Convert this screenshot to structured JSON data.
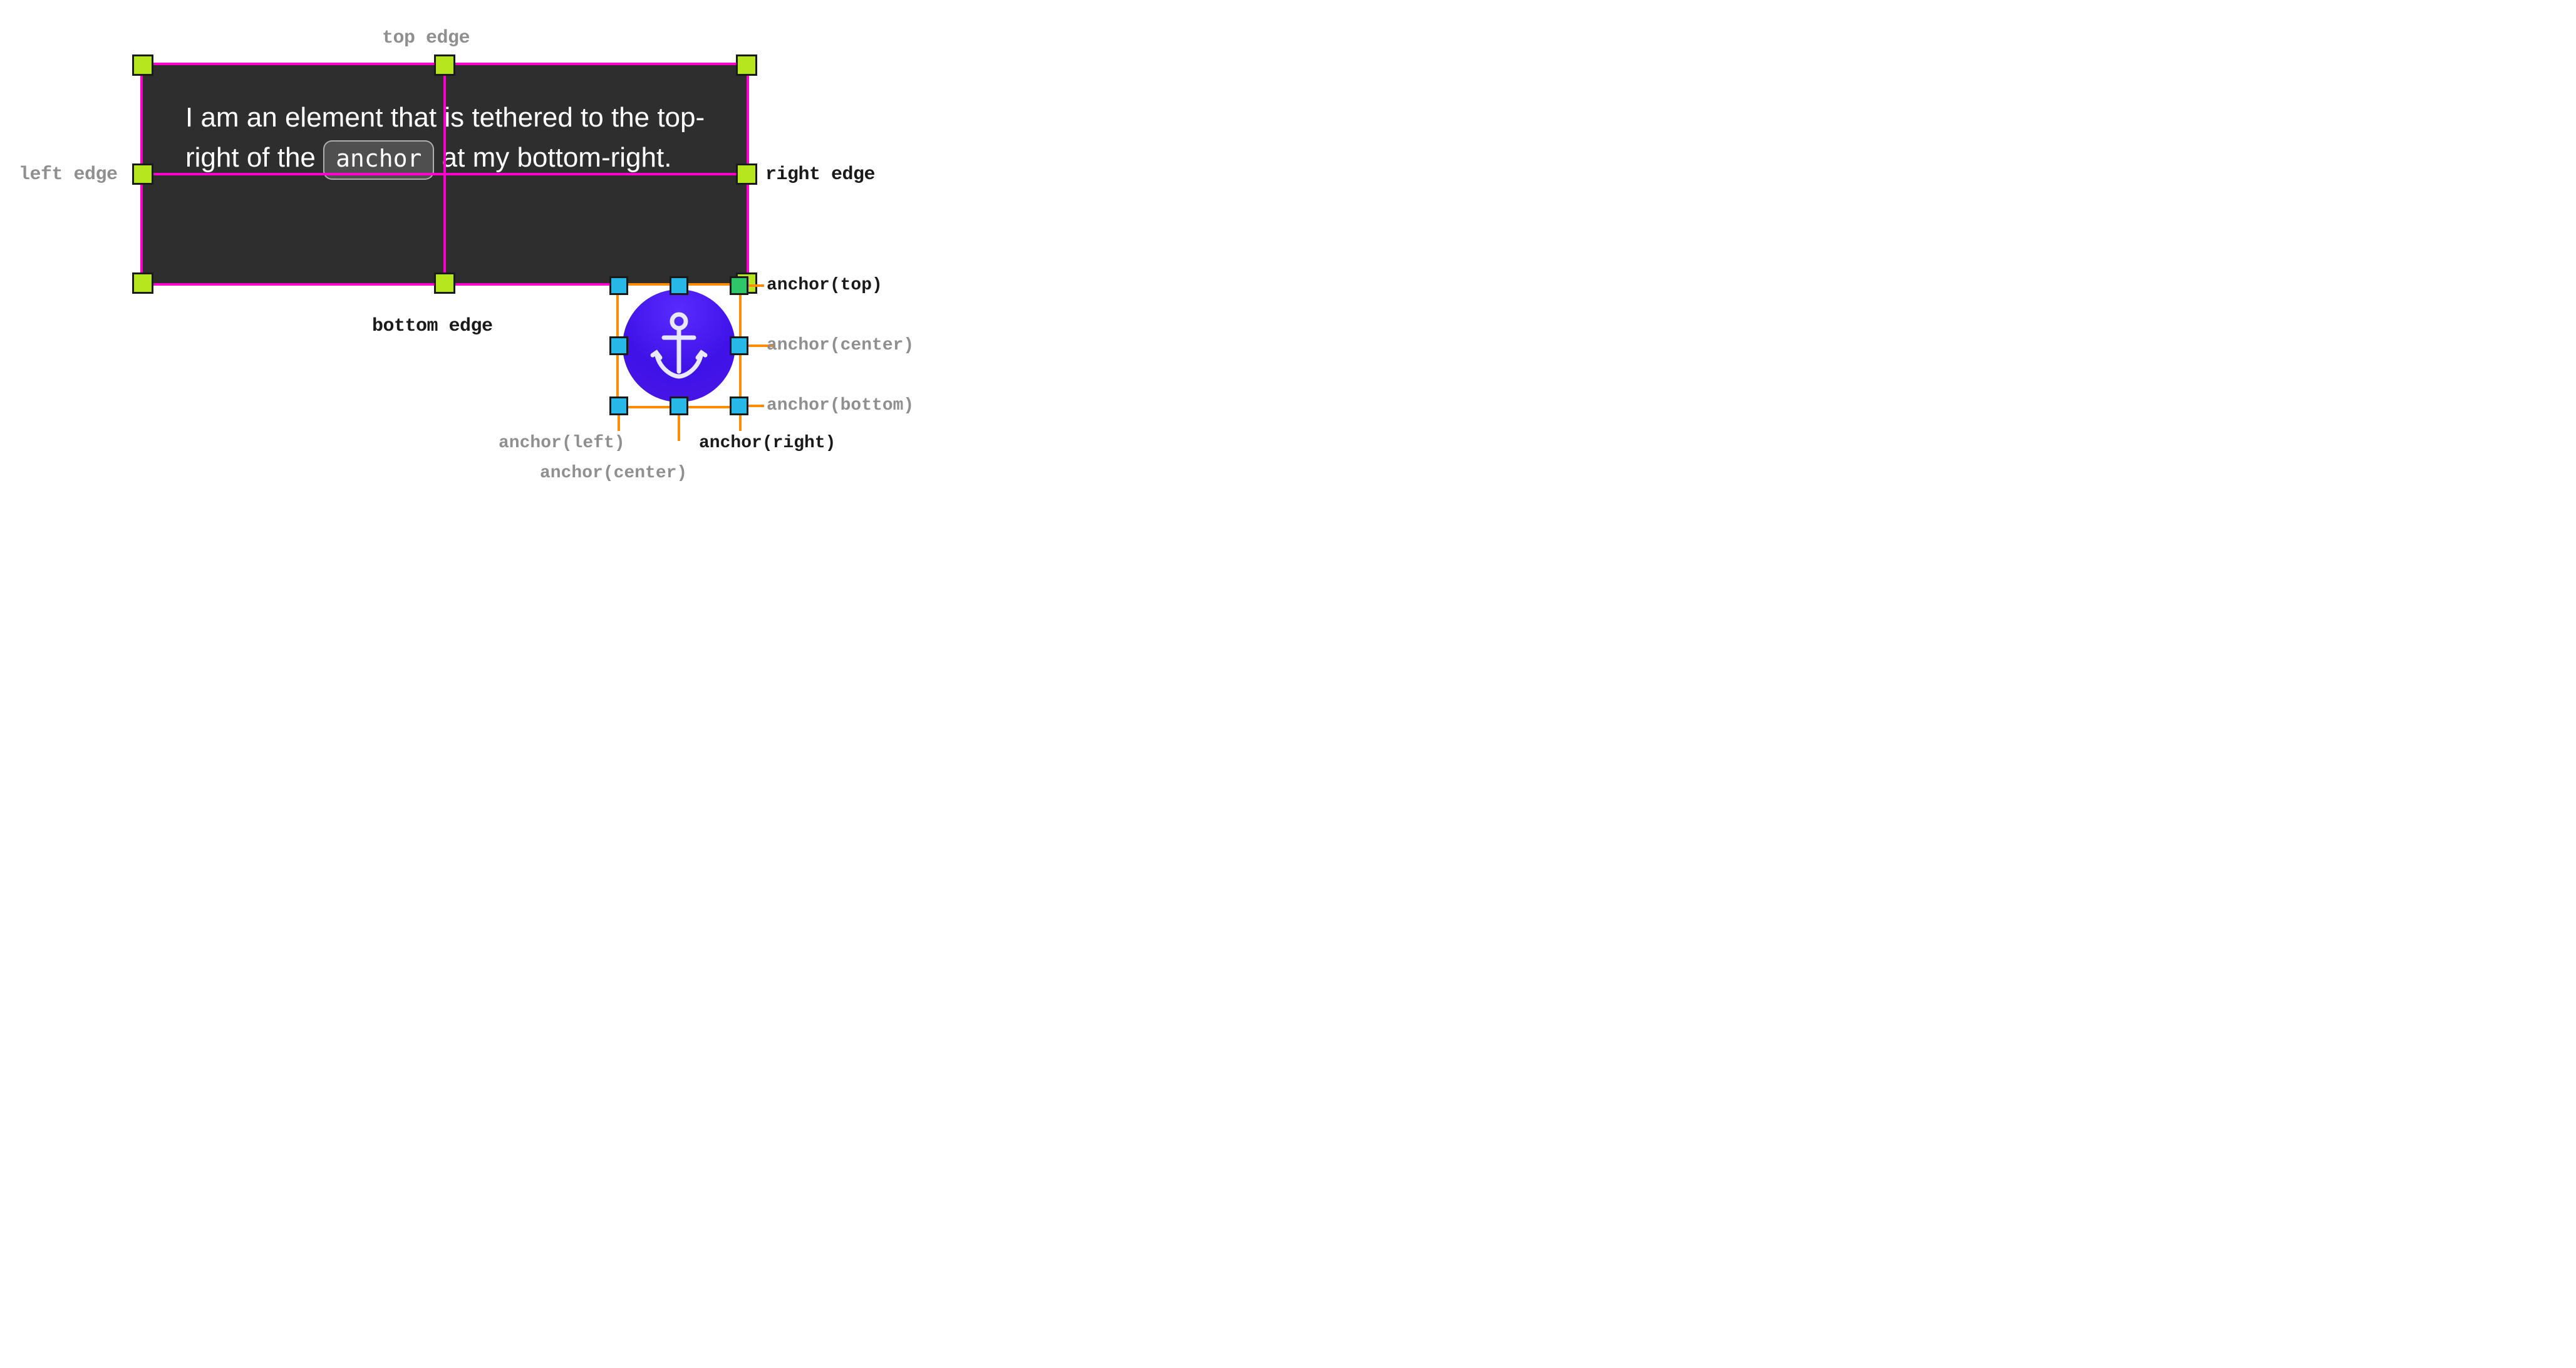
{
  "tethered_element": {
    "text_before_keyword": "I am an element that is tethered to the top-right of the ",
    "keyword": "anchor",
    "text_after_keyword": " at my bottom-right.",
    "border_color": "#ff00cc",
    "handle_color": "#b6e61e",
    "edge_labels": {
      "top": "top edge",
      "left": "left edge",
      "right": "right edge",
      "bottom": "bottom edge"
    },
    "highlighted_edges": [
      "right",
      "bottom"
    ]
  },
  "anchor_element": {
    "icon": "anchor-icon",
    "border_color": "#ff8c00",
    "handle_color": "#28b8e8",
    "labels": {
      "top": "anchor(top)",
      "center_h": "anchor(center)",
      "bottom": "anchor(bottom)",
      "left": "anchor(left)",
      "center_v": "anchor(center)",
      "right": "anchor(right)"
    },
    "highlighted_labels": [
      "top",
      "right"
    ]
  }
}
